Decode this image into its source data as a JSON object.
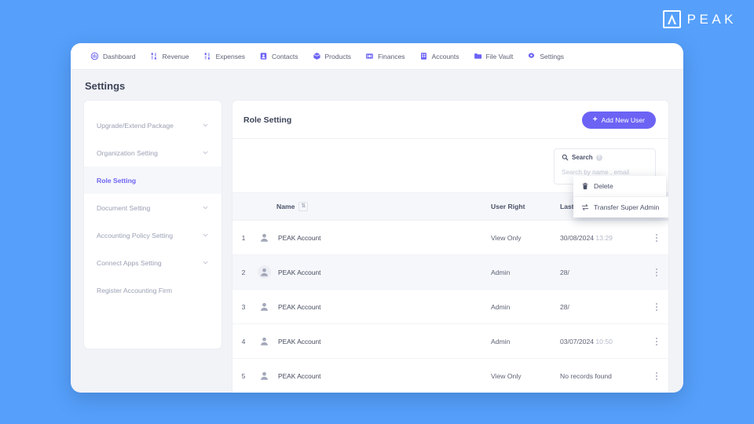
{
  "brand": {
    "name": "PEAK",
    "mark_icon": "peak-lambda-logo"
  },
  "topnav": {
    "items": [
      {
        "label": "Dashboard",
        "icon": "dashboard-gauge-icon"
      },
      {
        "label": "Revenue",
        "icon": "sliders-icon"
      },
      {
        "label": "Expenses",
        "icon": "sliders-icon"
      },
      {
        "label": "Contacts",
        "icon": "contacts-book-icon"
      },
      {
        "label": "Products",
        "icon": "box-cube-icon"
      },
      {
        "label": "Finances",
        "icon": "banknote-icon"
      },
      {
        "label": "Accounts",
        "icon": "building-columns-icon"
      },
      {
        "label": "File Vault",
        "icon": "folder-icon"
      },
      {
        "label": "Settings",
        "icon": "gear-icon"
      }
    ]
  },
  "page": {
    "title": "Settings"
  },
  "sidebar": {
    "items": [
      {
        "label": "Upgrade/Extend Package",
        "expandable": true,
        "active": false
      },
      {
        "label": "Organization Setting",
        "expandable": true,
        "active": false
      },
      {
        "label": "Role Setting",
        "expandable": false,
        "active": true
      },
      {
        "label": "Document Setting",
        "expandable": true,
        "active": false
      },
      {
        "label": "Accounting Policy Setting",
        "expandable": true,
        "active": false
      },
      {
        "label": "Connect Apps Setting",
        "expandable": true,
        "active": false
      },
      {
        "label": "Register Accounting Firm",
        "expandable": false,
        "active": false
      }
    ]
  },
  "main": {
    "title": "Role Setting",
    "add_user_button": "Add New User",
    "search": {
      "label": "Search",
      "placeholder": "Search by name , email",
      "value": ""
    },
    "table": {
      "headers": {
        "index": "",
        "name": "Name",
        "user_right": "User Right",
        "last_login": "Last Login",
        "menu": ""
      },
      "rows": [
        {
          "index": "1",
          "name": "PEAK Account",
          "user_right": "View Only",
          "last_login_date": "30/08/2024",
          "last_login_time": "13:29"
        },
        {
          "index": "2",
          "name": "PEAK Account",
          "user_right": "Admin",
          "last_login_date": "28/",
          "last_login_time": ""
        },
        {
          "index": "3",
          "name": "PEAK Account",
          "user_right": "Admin",
          "last_login_date": "28/",
          "last_login_time": ""
        },
        {
          "index": "4",
          "name": "PEAK Account",
          "user_right": "Admin",
          "last_login_date": "03/07/2024",
          "last_login_time": "10:50"
        },
        {
          "index": "5",
          "name": "PEAK Account",
          "user_right": "View Only",
          "last_login_date": "No records found",
          "last_login_time": ""
        }
      ]
    },
    "context_menu": {
      "items": [
        {
          "label": "Delete",
          "icon": "trash-icon"
        },
        {
          "label": "Transfer Super Admin",
          "icon": "transfer-arrows-icon"
        }
      ]
    }
  },
  "colors": {
    "page_background": "#56a0fb",
    "accent": "#6c63f5",
    "surface": "#ffffff",
    "surface_alt": "#f6f7fa",
    "text_primary": "#3d4458",
    "text_muted": "#9aa0b4"
  }
}
